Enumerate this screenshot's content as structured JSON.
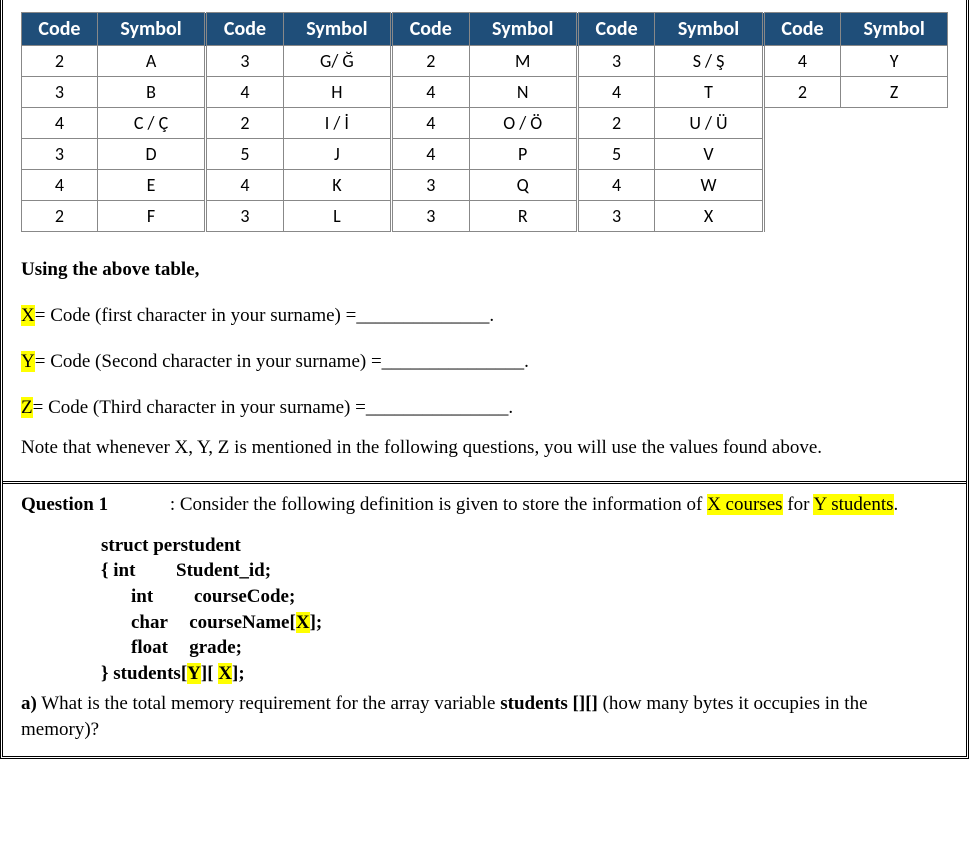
{
  "table": {
    "headers": [
      "Code",
      "Symbol",
      "Code",
      "Symbol",
      "Code",
      "Symbol",
      "Code",
      "Symbol",
      "Code",
      "Symbol"
    ],
    "rows": [
      [
        "2",
        "A",
        "3",
        "G/ Ğ",
        "2",
        "M",
        "3",
        "S / Ş",
        "4",
        "Y"
      ],
      [
        "3",
        "B",
        "4",
        "H",
        "4",
        "N",
        "4",
        "T",
        "2",
        "Z"
      ],
      [
        "4",
        "C / Ç",
        "2",
        "I / İ",
        "4",
        "O / Ö",
        "2",
        "U / Ü",
        "",
        ""
      ],
      [
        "3",
        "D",
        "5",
        "J",
        "4",
        "P",
        "5",
        "V",
        "",
        ""
      ],
      [
        "4",
        "E",
        "4",
        "K",
        "3",
        "Q",
        "4",
        "W",
        "",
        ""
      ],
      [
        "2",
        "F",
        "3",
        "L",
        "3",
        "R",
        "3",
        "X",
        "",
        ""
      ]
    ]
  },
  "instructions": {
    "heading": "Using the above table,",
    "x_label": "X",
    "x_text": "= Code (first character in your surname) =______________.",
    "y_label": "Y",
    "y_text": "= Code (Second character in your surname) =_______________.",
    "z_label": "Z",
    "z_text": "= Code (Third character in your surname) =_______________.",
    "note": "Note that whenever X, Y, Z is mentioned in the following questions, you will use the values found above."
  },
  "question": {
    "title": "Question 1",
    "intro_before": ": Consider the following definition is given to store the information of ",
    "hl1": "X courses",
    "middle": " for ",
    "hl2": "Y students",
    "after": ".",
    "struct_name": "struct perstudent",
    "line1_open": "{  int",
    "line1_field": "Student_id;",
    "line2_type": "int",
    "line2_field": "courseCode;",
    "line3_type": "char",
    "line3_field_before": "courseName[",
    "line3_hl": "X",
    "line3_field_after": "];",
    "line4_type": "float",
    "line4_field": "grade;",
    "line5_close_before": "} students[",
    "line5_hl_y": "Y",
    "line5_mid": "][ ",
    "line5_hl_x": "X",
    "line5_close_after": "];",
    "part_a_label": "a)",
    "part_a_text_before": " What is the total memory requirement for the array variable ",
    "part_a_bold": "students [][]",
    "part_a_text_after": " (how many bytes it occupies in the memory)?"
  }
}
